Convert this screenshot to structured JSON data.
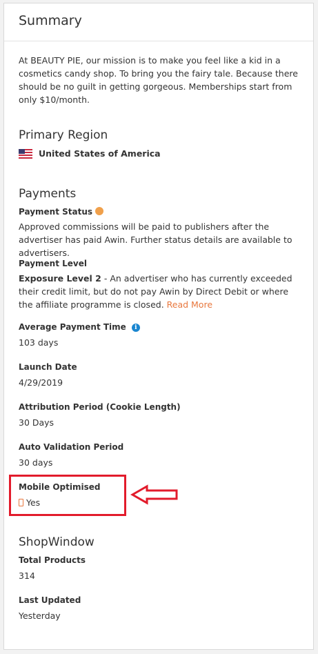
{
  "summary": {
    "title": "Summary",
    "description": "At BEAUTY PIE, our mission is to make you feel like a kid in a cosmetics candy shop. To bring you the fairy tale. Because there should be no guilt in getting gorgeous. Memberships start from only $10/month."
  },
  "primary_region": {
    "heading": "Primary Region",
    "country": "United States of America",
    "flag_icon": "us-flag-icon"
  },
  "payments": {
    "heading": "Payments",
    "status_label": "Payment Status",
    "status_color": "#f0a04b",
    "status_text": "Approved commissions will be paid to publishers after the advertiser has paid Awin. Further status details are available to advertisers.",
    "level_label": "Payment Level",
    "level_name": "Exposure Level 2",
    "level_text": " - An advertiser who has currently exceeded their credit limit, but do not pay Awin by Direct Debit or where the affiliate programme is closed. ",
    "read_more": "Read More",
    "avg_payment_time_label": "Average Payment Time",
    "avg_payment_time": "103 days",
    "launch_date_label": "Launch Date",
    "launch_date": "4/29/2019",
    "attribution_label": "Attribution Period (Cookie Length)",
    "attribution": "30 Days",
    "auto_validation_label": "Auto Validation Period",
    "auto_validation": "30 days",
    "mobile_label": "Mobile Optimised",
    "mobile_value": "Yes"
  },
  "shopwindow": {
    "heading": "ShopWindow",
    "total_products_label": "Total Products",
    "total_products": "314",
    "last_updated_label": "Last Updated",
    "last_updated": "Yesterday"
  },
  "annotation": {
    "highlight_color": "#e21b2b"
  }
}
